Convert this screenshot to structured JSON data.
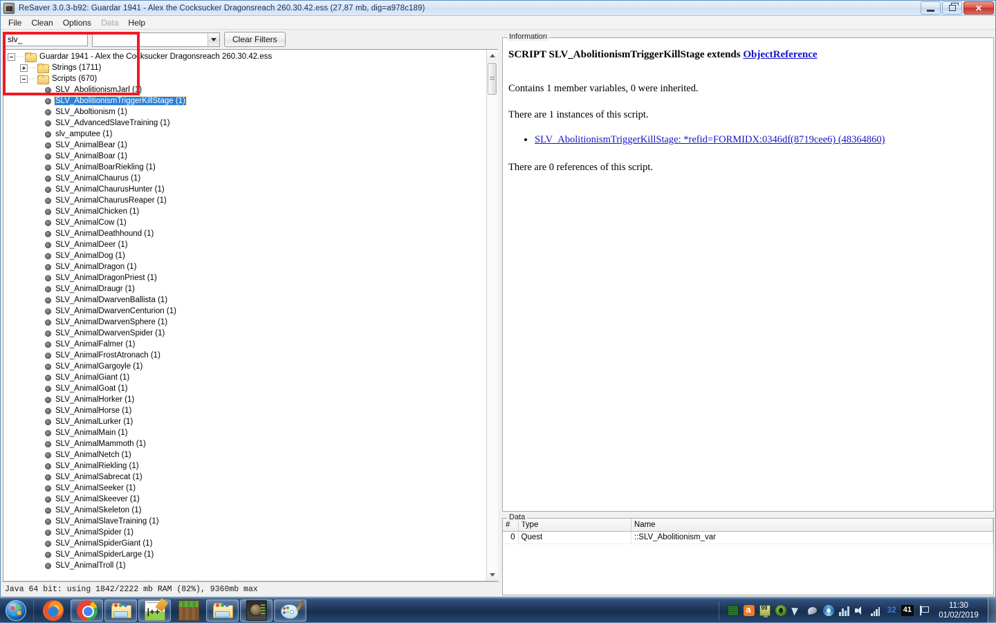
{
  "window": {
    "title": "ReSaver 3.0.3-b92: Guardar 1941 - Alex the Cocksucker  Dragonsreach  260.30.42.ess (27,87 mb, dig=a978c189)",
    "icon": "resaver-app-icon",
    "minimize_label": "Minimize",
    "maximize_label": "Restore",
    "close_label": "Close"
  },
  "menu": {
    "items": [
      {
        "label": "File",
        "disabled": false
      },
      {
        "label": "Clean",
        "disabled": false
      },
      {
        "label": "Options",
        "disabled": false
      },
      {
        "label": "Data",
        "disabled": true
      },
      {
        "label": "Help",
        "disabled": false
      }
    ]
  },
  "toolbar": {
    "filter_text_value": "slv_",
    "filter_text_placeholder": "",
    "filter_combo_value": "",
    "filter_combo_placeholder": "",
    "clear_filters_label": "Clear Filters"
  },
  "tree": {
    "root": {
      "label": "Guardar 1941 - Alex the Cocksucker  Dragonsreach  260.30.42.ess",
      "expanded": true
    },
    "groups": [
      {
        "label": "Strings (1711)",
        "expanded": false
      },
      {
        "label": "Scripts (670)",
        "expanded": true
      }
    ],
    "hidden_first_item": "SLV_AbolitionismJarl (1)",
    "items": [
      {
        "label": "SLV_AbolitionismTriggerKillStage (1)",
        "selected": true
      },
      {
        "label": "SLV_Aboltionism (1)",
        "selected": false
      },
      {
        "label": "SLV_AdvancedSlaveTraining (1)",
        "selected": false
      },
      {
        "label": "slv_amputee (1)",
        "selected": false
      },
      {
        "label": "SLV_AnimalBear (1)",
        "selected": false
      },
      {
        "label": "SLV_AnimalBoar (1)",
        "selected": false
      },
      {
        "label": "SLV_AnimalBoarRiekling (1)",
        "selected": false
      },
      {
        "label": "SLV_AnimalChaurus (1)",
        "selected": false
      },
      {
        "label": "SLV_AnimalChaurusHunter (1)",
        "selected": false
      },
      {
        "label": "SLV_AnimalChaurusReaper (1)",
        "selected": false
      },
      {
        "label": "SLV_AnimalChicken (1)",
        "selected": false
      },
      {
        "label": "SLV_AnimalCow (1)",
        "selected": false
      },
      {
        "label": "SLV_AnimalDeathhound (1)",
        "selected": false
      },
      {
        "label": "SLV_AnimalDeer (1)",
        "selected": false
      },
      {
        "label": "SLV_AnimalDog (1)",
        "selected": false
      },
      {
        "label": "SLV_AnimalDragon (1)",
        "selected": false
      },
      {
        "label": "SLV_AnimalDragonPriest (1)",
        "selected": false
      },
      {
        "label": "SLV_AnimalDraugr (1)",
        "selected": false
      },
      {
        "label": "SLV_AnimalDwarvenBallista (1)",
        "selected": false
      },
      {
        "label": "SLV_AnimalDwarvenCenturion (1)",
        "selected": false
      },
      {
        "label": "SLV_AnimalDwarvenSphere (1)",
        "selected": false
      },
      {
        "label": "SLV_AnimalDwarvenSpider (1)",
        "selected": false
      },
      {
        "label": "SLV_AnimalFalmer (1)",
        "selected": false
      },
      {
        "label": "SLV_AnimalFrostAtronach (1)",
        "selected": false
      },
      {
        "label": "SLV_AnimalGargoyle (1)",
        "selected": false
      },
      {
        "label": "SLV_AnimalGiant (1)",
        "selected": false
      },
      {
        "label": "SLV_AnimalGoat (1)",
        "selected": false
      },
      {
        "label": "SLV_AnimalHorker (1)",
        "selected": false
      },
      {
        "label": "SLV_AnimalHorse (1)",
        "selected": false
      },
      {
        "label": "SLV_AnimalLurker (1)",
        "selected": false
      },
      {
        "label": "SLV_AnimalMain (1)",
        "selected": false
      },
      {
        "label": "SLV_AnimalMammoth (1)",
        "selected": false
      },
      {
        "label": "SLV_AnimalNetch (1)",
        "selected": false
      },
      {
        "label": "SLV_AnimalRiekling (1)",
        "selected": false
      },
      {
        "label": "SLV_AnimalSabrecat (1)",
        "selected": false
      },
      {
        "label": "SLV_AnimalSeeker (1)",
        "selected": false
      },
      {
        "label": "SLV_AnimalSkeever (1)",
        "selected": false
      },
      {
        "label": "SLV_AnimalSkeleton (1)",
        "selected": false
      },
      {
        "label": "SLV_AnimalSlaveTraining (1)",
        "selected": false
      },
      {
        "label": "SLV_AnimalSpider (1)",
        "selected": false
      },
      {
        "label": "SLV_AnimalSpiderGiant (1)",
        "selected": false
      },
      {
        "label": "SLV_AnimalSpiderLarge (1)",
        "selected": false
      },
      {
        "label": "SLV_AnimalTroll (1)",
        "selected": false
      }
    ]
  },
  "information": {
    "panel_title": "Information",
    "heading_prefix": "SCRIPT SLV_AbolitionismTriggerKillStage extends ",
    "heading_link": "ObjectReference",
    "members_line": "Contains 1 member variables, 0 were inherited.",
    "instances_line": "There are 1 instances of this script.",
    "instance_link": "SLV_AbolitionismTriggerKillStage: *refid=FORMIDX:0346df(8719cee6) (48364860)",
    "references_line": "There are 0 references of this script.",
    "link_color": "#1414c8"
  },
  "data_panel": {
    "panel_title": "Data",
    "columns": [
      "#",
      "Type",
      "Name"
    ],
    "rows": [
      {
        "num": "0",
        "type": "Quest",
        "name": "::SLV_Abolitionism_var"
      }
    ]
  },
  "statusbar": {
    "text": "Java 64 bit: using 1842/2222 mb RAM (82%), 9360mb max"
  },
  "annotation": {
    "color": "#ee1b24",
    "shape": "rectangle-highlight"
  },
  "taskbar": {
    "start_label": "Start",
    "buttons": [
      {
        "name": "firefox",
        "label": "Mozilla Firefox"
      },
      {
        "name": "chrome",
        "label": "Google Chrome"
      },
      {
        "name": "explorer-1",
        "label": "Windows Explorer"
      },
      {
        "name": "notepadpp",
        "label": "Notepad++"
      },
      {
        "name": "minecraft",
        "label": "Minecraft"
      },
      {
        "name": "explorer-2",
        "label": "Windows Explorer"
      },
      {
        "name": "resaver",
        "label": "ReSaver"
      },
      {
        "name": "paint",
        "label": "Paint"
      }
    ],
    "tray": [
      {
        "name": "grid-icon",
        "label": ""
      },
      {
        "name": "avast-icon",
        "label": ""
      },
      {
        "name": "monitor-icon",
        "label": "99"
      },
      {
        "name": "nvidia-icon",
        "label": ""
      },
      {
        "name": "cursor-arrow-icon",
        "label": ""
      },
      {
        "name": "satellite-dish-icon",
        "label": ""
      },
      {
        "name": "swirl-icon",
        "label": ""
      },
      {
        "name": "equalizer-icon",
        "label": ""
      },
      {
        "name": "volume-icon",
        "label": ""
      },
      {
        "name": "network-signal-icon",
        "label": ""
      },
      {
        "name": "badge-32",
        "label": "32"
      },
      {
        "name": "badge-41",
        "label": "41"
      },
      {
        "name": "flag-icon",
        "label": ""
      }
    ],
    "clock_time": "11:30",
    "clock_date": "01/02/2019"
  }
}
